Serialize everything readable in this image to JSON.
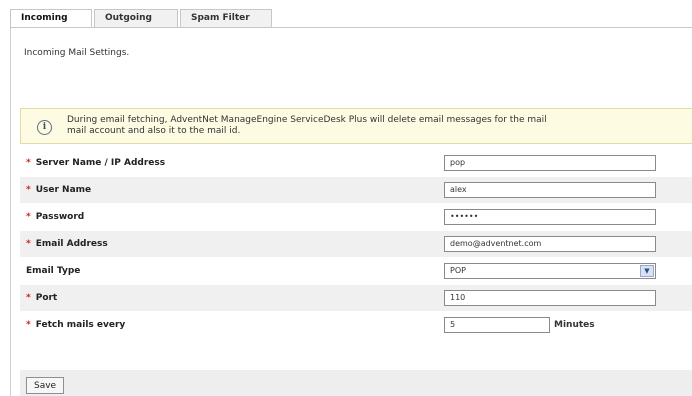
{
  "tabs": [
    {
      "label": "Incoming"
    },
    {
      "label": "Outgoing"
    },
    {
      "label": "Spam Filter"
    }
  ],
  "heading": "Incoming Mail Settings.",
  "notice": {
    "icon": "info-icon",
    "text": "During email fetching, AdventNet ManageEngine ServiceDesk Plus will delete email messages for the mail\nmail account and also it to the mail id."
  },
  "fields": {
    "server": {
      "label": "Server Name / IP Address",
      "value": "pop"
    },
    "user": {
      "label": "User Name",
      "value": "alex"
    },
    "password": {
      "label": "Password",
      "value": "••••••"
    },
    "email": {
      "label": "Email Address",
      "value": "demo@adventnet.com"
    },
    "email_type": {
      "label": "Email Type",
      "value": "POP"
    },
    "port": {
      "label": "Port",
      "value": "110"
    },
    "fetch": {
      "label": "Fetch mails every",
      "value": "5",
      "suffix": "Minutes"
    }
  },
  "required_marker": "*",
  "save_label": "Save"
}
